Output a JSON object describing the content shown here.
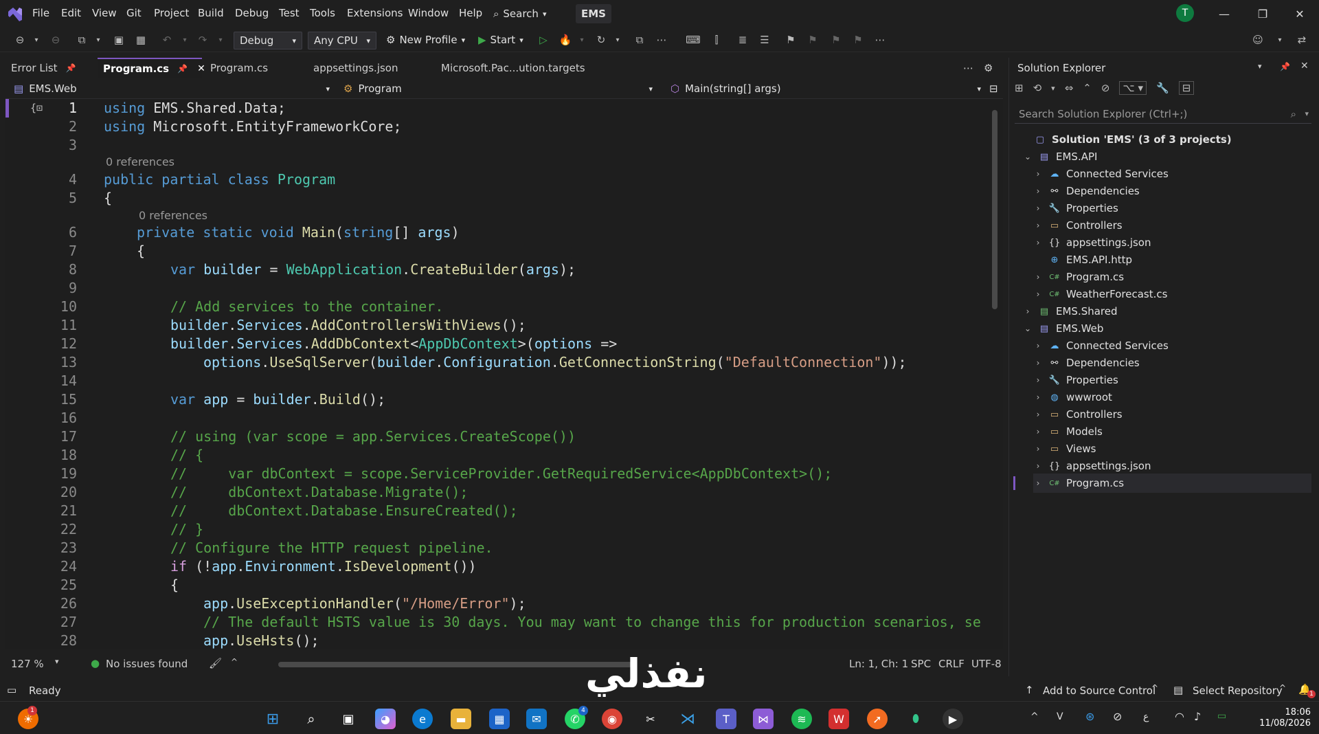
{
  "menu": [
    "File",
    "Edit",
    "View",
    "Git",
    "Project",
    "Build",
    "Debug",
    "Test",
    "Tools",
    "Extensions",
    "Window",
    "Help"
  ],
  "search_label": "Search",
  "solution_badge": "EMS",
  "avatar_initial": "T",
  "toolbar": {
    "config": "Debug",
    "platform": "Any CPU",
    "profile": "New Profile",
    "start": "Start"
  },
  "tabs": [
    {
      "label": "Error List"
    },
    {
      "label": "Program.cs"
    },
    {
      "label": "Program.cs"
    },
    {
      "label": "appsettings.json"
    },
    {
      "label": "Microsoft.Pac...ution.targets"
    }
  ],
  "nav": {
    "project": "EMS.Web",
    "type": "Program",
    "member": "Main(string[] args)"
  },
  "editor": {
    "lines": [
      {
        "n": "1",
        "refs": ""
      },
      {
        "n": "2",
        "refs": ""
      },
      {
        "n": "3",
        "refs": ""
      },
      {
        "n": "4",
        "refs": "0 references"
      },
      {
        "n": "5",
        "refs": ""
      },
      {
        "n": "6",
        "refs": "0 references"
      },
      {
        "n": "7"
      },
      {
        "n": "8"
      },
      {
        "n": "9"
      },
      {
        "n": "10"
      },
      {
        "n": "11"
      },
      {
        "n": "12"
      },
      {
        "n": "13"
      },
      {
        "n": "14"
      },
      {
        "n": "15"
      },
      {
        "n": "16"
      },
      {
        "n": "17"
      },
      {
        "n": "18"
      },
      {
        "n": "19"
      },
      {
        "n": "20"
      },
      {
        "n": "21"
      },
      {
        "n": "22"
      },
      {
        "n": "23"
      },
      {
        "n": "24"
      },
      {
        "n": "25"
      },
      {
        "n": "26"
      },
      {
        "n": "27"
      },
      {
        "n": "28"
      }
    ],
    "code": {
      "l1a": "using",
      "l1b": " EMS.Shared.Data;",
      "l2a": "using",
      "l2b": " Microsoft.EntityFrameworkCore;",
      "l4a": "public partial class",
      "l4b": "Program",
      "l5": "{",
      "l6a": "private static void",
      "l6b": "Main",
      "l6c": "(",
      "l6d": "string",
      "l6e": "[] ",
      "l6f": "args",
      "l6g": ")",
      "l7": "{",
      "l8a": "var",
      "l8b": "builder",
      "l8c": " = ",
      "l8d": "WebApplication",
      "l8e": ".",
      "l8f": "CreateBuilder",
      "l8g": "(",
      "l8h": "args",
      "l8i": ");",
      "l10": "// Add services to the container.",
      "l11a": "builder",
      "l11b": ".",
      "l11c": "Services",
      "l11d": ".",
      "l11e": "AddControllersWithViews",
      "l11f": "();",
      "l12a": "builder",
      "l12b": ".",
      "l12c": "Services",
      "l12d": ".",
      "l12e": "AddDbContext",
      "l12f": "<",
      "l12g": "AppDbContext",
      "l12h": ">(",
      "l12i": "options",
      "l12j": " =>",
      "l13a": "options",
      "l13b": ".",
      "l13c": "UseSqlServer",
      "l13d": "(",
      "l13e": "builder",
      "l13f": ".",
      "l13g": "Configuration",
      "l13h": ".",
      "l13i": "GetConnectionString",
      "l13j": "(",
      "l13k": "\"DefaultConnection\"",
      "l13l": "));",
      "l15a": "var",
      "l15b": "app",
      "l15c": " = ",
      "l15d": "builder",
      "l15e": ".",
      "l15f": "Build",
      "l15g": "();",
      "l17": "// using (var scope = app.Services.CreateScope())",
      "l18": "// {",
      "l19": "//     var dbContext = scope.ServiceProvider.GetRequiredService<AppDbContext>();",
      "l20": "//     dbContext.Database.Migrate();",
      "l21": "//     dbContext.Database.EnsureCreated();",
      "l22": "// }",
      "l23": "// Configure the HTTP request pipeline.",
      "l24a": "if",
      "l24b": " (!",
      "l24c": "app",
      "l24d": ".",
      "l24e": "Environment",
      "l24f": ".",
      "l24g": "IsDevelopment",
      "l24h": "())",
      "l25": "{",
      "l26a": "app",
      "l26b": ".",
      "l26c": "UseExceptionHandler",
      "l26d": "(",
      "l26e": "\"/Home/Error\"",
      "l26f": ");",
      "l27": "// The default HSTS value is 30 days. You may want to change this for production scenarios, se",
      "l28a": "app",
      "l28b": ".",
      "l28c": "UseHsts",
      "l28d": "();"
    }
  },
  "editor_status": {
    "zoom": "127 %",
    "issues": "No issues found",
    "position": "Ln: 1, Ch: 1",
    "spacing": "SPC",
    "line_ending": "CRLF",
    "encoding": "UTF-8"
  },
  "solution_explorer": {
    "title": "Solution Explorer",
    "search_placeholder": "Search Solution Explorer (Ctrl+;)",
    "items": [
      {
        "label": "Solution 'EMS' (3 of 3 projects)"
      },
      {
        "label": "EMS.API"
      },
      {
        "label": "Connected Services"
      },
      {
        "label": "Dependencies"
      },
      {
        "label": "Properties"
      },
      {
        "label": "Controllers"
      },
      {
        "label": "appsettings.json"
      },
      {
        "label": "EMS.API.http"
      },
      {
        "label": "Program.cs"
      },
      {
        "label": "WeatherForecast.cs"
      },
      {
        "label": "EMS.Shared"
      },
      {
        "label": "EMS.Web"
      },
      {
        "label": "Connected Services"
      },
      {
        "label": "Dependencies"
      },
      {
        "label": "Properties"
      },
      {
        "label": "wwwroot"
      },
      {
        "label": "Controllers"
      },
      {
        "label": "Models"
      },
      {
        "label": "Views"
      },
      {
        "label": "appsettings.json"
      },
      {
        "label": "Program.cs"
      }
    ]
  },
  "statusbar": {
    "ready": "Ready",
    "source_control": "Add to Source Control",
    "repository": "Select Repository"
  },
  "taskbar": {
    "time": "18:06",
    "date": "11/08/2026",
    "notif_badge": "1",
    "whatsapp_badge": "4",
    "lang": "ع"
  },
  "watermark": "نفذلي",
  "colors": {
    "accent": "#7e57c2",
    "keyword": "#569cd6",
    "type": "#4ec9b0",
    "method": "#dcdcaa",
    "variable": "#9cdcfe",
    "comment": "#57a64a",
    "string": "#d69d85"
  }
}
